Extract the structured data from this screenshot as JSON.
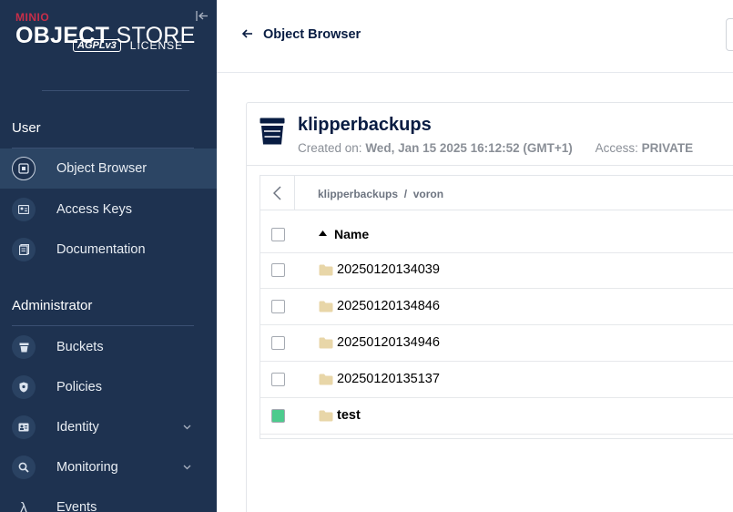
{
  "sidebar": {
    "brand": {
      "vendor": "MINIO",
      "product_bold": "OBJECT",
      "product_light": "STORE",
      "agpl": "AGPLv3",
      "license": "LICENSE"
    },
    "collapse_icon": "collapse-left-icon",
    "sections": [
      {
        "title": "User",
        "items": [
          {
            "label": "Object Browser",
            "icon": "object-browser-icon",
            "active": true
          },
          {
            "label": "Access Keys",
            "icon": "access-keys-icon"
          },
          {
            "label": "Documentation",
            "icon": "documentation-icon"
          }
        ]
      },
      {
        "title": "Administrator",
        "items": [
          {
            "label": "Buckets",
            "icon": "bucket-icon"
          },
          {
            "label": "Policies",
            "icon": "shield-icon"
          },
          {
            "label": "Identity",
            "icon": "id-card-icon",
            "expandable": true
          },
          {
            "label": "Monitoring",
            "icon": "magnify-icon",
            "expandable": true
          },
          {
            "label": "Events",
            "icon": "lambda-icon"
          }
        ]
      }
    ]
  },
  "topbar": {
    "back_icon": "arrow-left-icon",
    "title": "Object Browser"
  },
  "bucket": {
    "name": "klipperbackups",
    "created_label": "Created on:",
    "created_value": "Wed, Jan 15 2025 16:12:52 (GMT+1)",
    "access_label": "Access:",
    "access_value": "PRIVATE"
  },
  "browser": {
    "breadcrumb": "klipperbackups  /  voron",
    "header": {
      "name": "Name",
      "sort": "ascending"
    },
    "rows": [
      {
        "name": "20250120134039",
        "type": "folder",
        "checked": false
      },
      {
        "name": "20250120134846",
        "type": "folder",
        "checked": false
      },
      {
        "name": "20250120134946",
        "type": "folder",
        "checked": false
      },
      {
        "name": "20250120135137",
        "type": "folder",
        "checked": false
      },
      {
        "name": "test",
        "type": "folder",
        "checked": true
      }
    ]
  },
  "colors": {
    "sidebar_bg": "#1e3250",
    "brand_red": "#c72e49",
    "checked_green": "#4ccb8d",
    "folder_tan": "#e8d6a8",
    "title_navy": "#081c42"
  }
}
